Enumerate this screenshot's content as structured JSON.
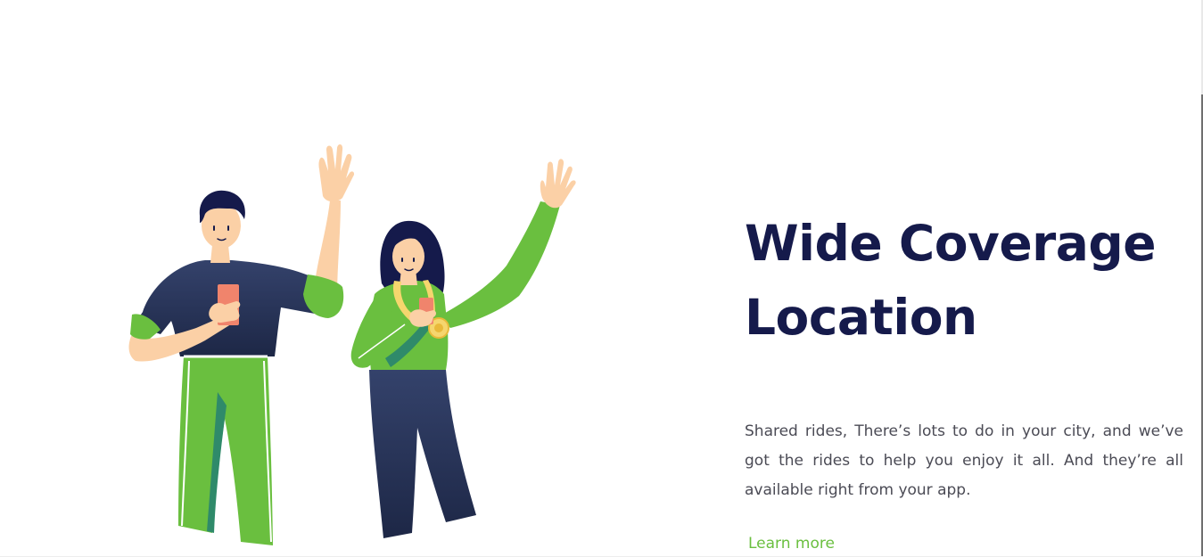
{
  "section": {
    "title_line1": "Wide Coverage",
    "title_line2": "Location",
    "description": "Shared rides, There’s lots to do in your city, and we’ve got the rides to help you enjoy it all. And they’re all available right from your app.",
    "cta_label": "Learn more"
  },
  "colors": {
    "title": "#151a4b",
    "body_text": "#4b4b55",
    "accent_green": "#6abf3f",
    "navy": "#2b3659",
    "skin": "#fbd0a6",
    "phone": "#f0846c",
    "medal": "#f5d66e"
  },
  "illustration": {
    "icon": "two-people-waving-illustration"
  }
}
